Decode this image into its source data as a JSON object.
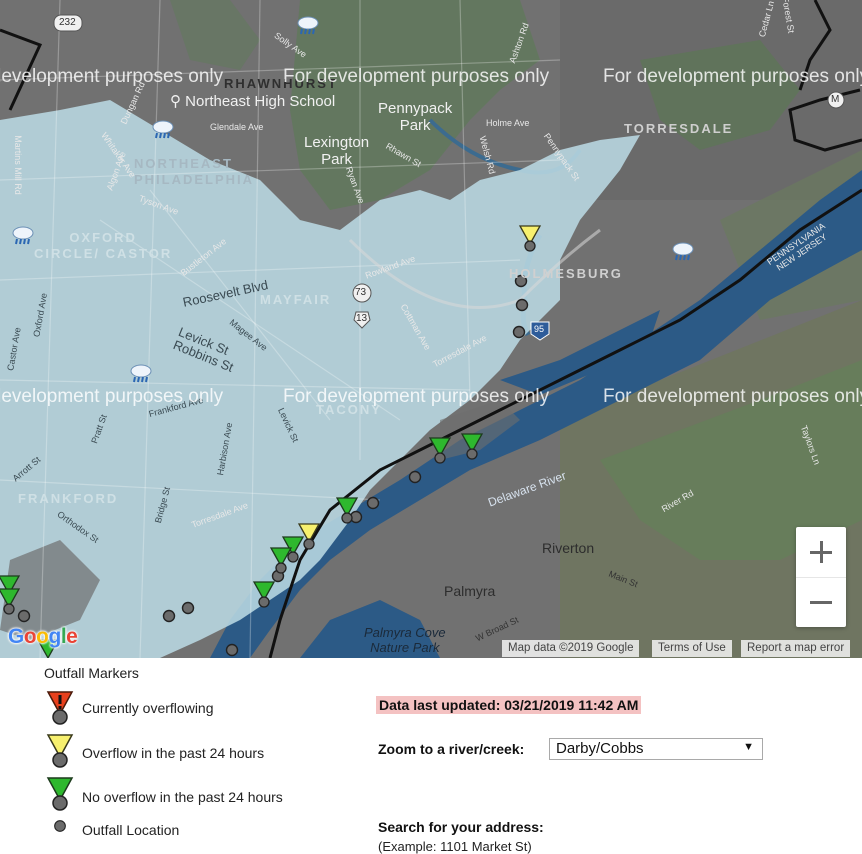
{
  "map": {
    "watermark_text": "For development purposes only",
    "labels": {
      "rhawnhurst": "RHAWNHURST",
      "northeast_high": "Northeast High School",
      "pennypack_park": "Pennypack\nPark",
      "lexington_park": "Lexington\nPark",
      "torresdale": "TORRESDALE",
      "northeast_philadelphia": "NORTHEAST\nPHILADELPHIA",
      "oxford_circle": "OXFORD\nCIRCLE/ CASTOR",
      "mayfair": "MAYFAIR",
      "holmesburg": "HOLMESBURG",
      "tacony": "TACONY",
      "frankford": "FRANKFORD",
      "delaware_river": "Delaware River",
      "riverton": "Riverton",
      "palmyra": "Palmyra",
      "palmyra_cove": "Palmyra Cove\nNature Park",
      "pennsylvania_nj": "PENNSYLVANIA\nNEW JERSEY",
      "roosevelt_blvd": "Roosevelt Blvd",
      "levick_robbins": "Levick St\nRobbins St",
      "rhawn_st": "Rhawn St",
      "ryan_ave": "Ryan Ave",
      "holme_ave": "Holme Ave",
      "welsh_rd": "Welsh Rd",
      "ashton_rd": "Ashton Rd",
      "pennypack_st": "Pennypack St",
      "glendale_ave": "Glendale Ave",
      "solly_ave": "Solly Ave",
      "dungan_rd": "Dungan Rd",
      "whitaker_ave": "Whitaker Ave",
      "martins_mill": "Martins Mill Rd",
      "algon_ave": "Algon Ave",
      "tyson_ave": "Tyson Ave",
      "bustleton_ave": "Bustleton Ave",
      "rowland_ave": "Rowland Ave",
      "cottman_ave": "Cottman Ave",
      "torresdale_ave": "Torresdale Ave",
      "magee_ave": "Magee Ave",
      "pratt_st": "Pratt St",
      "arrott_st": "Arrott St",
      "orthodox_st": "Orthodox St",
      "bridge_st": "Bridge St",
      "harbison_ave": "Harbison Ave",
      "frankford_ave": "Frankford Ave",
      "oxford_ave": "Oxford Ave",
      "castor_ave": "Castor Ave",
      "levick_st": "Levick St",
      "taylors_ln": "Taylors Ln",
      "river_rd": "River Rd",
      "main_st": "Main St",
      "w_broad_st": "W Broad St",
      "route_73": "73",
      "route_13": "13",
      "route_95": "95",
      "route_232": "232",
      "route_m": "M",
      "cedar_ln": "Cedar Ln",
      "forest_st": "Forest St"
    },
    "attribution": {
      "map_data": "Map data ©2019 Google",
      "terms": "Terms of Use",
      "report": "Report a map error"
    },
    "google_logo": [
      "G",
      "o",
      "o",
      "g",
      "l",
      "e"
    ],
    "google_colors": [
      "#4285F4",
      "#EA4335",
      "#FBBC05",
      "#4285F4",
      "#34A853",
      "#EA4335"
    ],
    "colors": {
      "overflowing": "#e8401c",
      "overflow_24h": "#f7f06e",
      "no_overflow": "#2eb82e",
      "outfall": "#6b6b6b",
      "river": "#2c5a86",
      "shaded_area": "#b9d8e3"
    }
  },
  "legend": {
    "title": "Outfall Markers",
    "items": [
      {
        "label": "Currently overflowing",
        "marker": "red-exclamation-triangle"
      },
      {
        "label": "Overflow in the past 24 hours",
        "marker": "yellow-triangle"
      },
      {
        "label": "No overflow in the past 24 hours",
        "marker": "green-triangle"
      },
      {
        "label": "Outfall Location",
        "marker": "gray-circle"
      }
    ]
  },
  "panel": {
    "last_updated": "Data last updated: 03/21/2019 11:42 AM",
    "zoom_label": "Zoom to a river/creek:",
    "zoom_selected": "Darby/Cobbs",
    "search_label": "Search for your address:",
    "search_example": "(Example: 1101 Market St)"
  }
}
